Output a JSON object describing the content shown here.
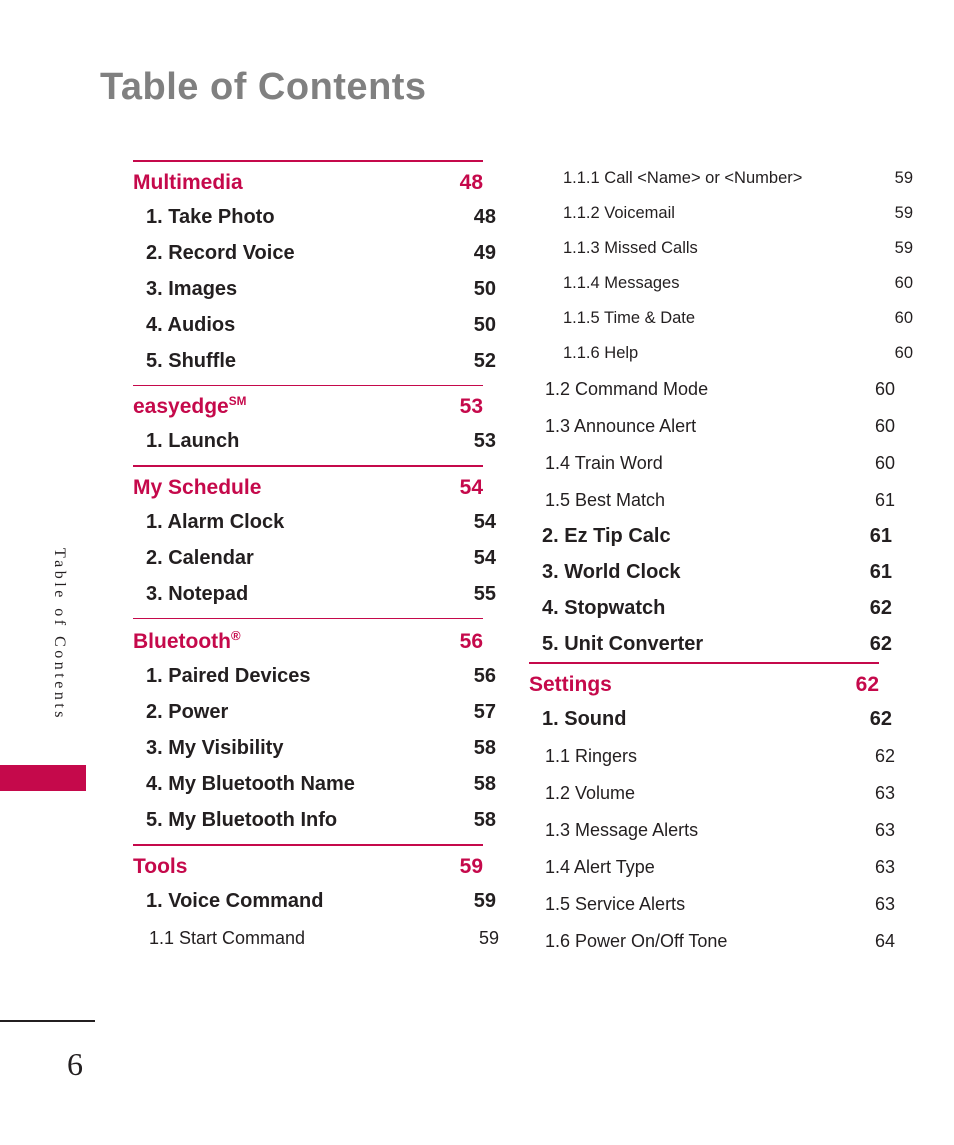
{
  "page": {
    "title": "Table of Contents",
    "side_tab_label": "Table of Contents",
    "page_number": "6",
    "accent_color": "#c5094b",
    "title_color": "#808080",
    "text_color": "#231f20"
  },
  "left_column": [
    {
      "header": {
        "label": "Multimedia",
        "page": "48",
        "level": "header"
      },
      "items": [
        {
          "label": "1. Take Photo",
          "page": "48",
          "level": 1
        },
        {
          "label": "2. Record Voice",
          "page": "49",
          "level": 1
        },
        {
          "label": "3. Images",
          "page": "50",
          "level": 1
        },
        {
          "label": "4. Audios",
          "page": "50",
          "level": 1
        },
        {
          "label": "5. Shuffle",
          "page": "52",
          "level": 1
        }
      ]
    },
    {
      "header": {
        "label": "easyedge",
        "superscript": "SM",
        "page": "53",
        "level": "header"
      },
      "items": [
        {
          "label": "1. Launch",
          "page": "53",
          "level": 1
        }
      ]
    },
    {
      "header": {
        "label": "My Schedule",
        "page": "54",
        "level": "header"
      },
      "items": [
        {
          "label": "1. Alarm Clock",
          "page": "54",
          "level": 1
        },
        {
          "label": "2. Calendar",
          "page": "54",
          "level": 1
        },
        {
          "label": "3. Notepad",
          "page": "55",
          "level": 1
        }
      ]
    },
    {
      "header": {
        "label": "Bluetooth",
        "superscript": "®",
        "page": "56",
        "level": "header"
      },
      "items": [
        {
          "label": "1. Paired Devices",
          "page": "56",
          "level": 1
        },
        {
          "label": "2. Power",
          "page": "57",
          "level": 1
        },
        {
          "label": "3. My Visibility",
          "page": "58",
          "level": 1
        },
        {
          "label": "4. My Bluetooth Name",
          "page": "58",
          "level": 1
        },
        {
          "label": "5. My Bluetooth Info",
          "page": "58",
          "level": 1
        }
      ]
    },
    {
      "header": {
        "label": "Tools",
        "page": "59",
        "level": "header"
      },
      "items": [
        {
          "label": "1. Voice Command",
          "page": "59",
          "level": 1
        },
        {
          "label": "1.1 Start Command",
          "page": "59",
          "level": 2
        }
      ]
    }
  ],
  "right_column": [
    {
      "items": [
        {
          "label": "1.1.1 Call <Name> or <Number>",
          "page": "59",
          "level": 3
        },
        {
          "label": "1.1.2 Voicemail",
          "page": "59",
          "level": 3
        },
        {
          "label": "1.1.3 Missed Calls",
          "page": "59",
          "level": 3
        },
        {
          "label": "1.1.4 Messages",
          "page": "60",
          "level": 3
        },
        {
          "label": "1.1.5 Time & Date",
          "page": "60",
          "level": 3
        },
        {
          "label": "1.1.6 Help",
          "page": "60",
          "level": 3
        },
        {
          "label": "1.2 Command Mode",
          "page": "60",
          "level": 2
        },
        {
          "label": "1.3 Announce Alert",
          "page": "60",
          "level": 2
        },
        {
          "label": "1.4 Train Word",
          "page": "60",
          "level": 2
        },
        {
          "label": "1.5 Best Match",
          "page": "61",
          "level": 2
        },
        {
          "label": "2. Ez Tip Calc",
          "page": "61",
          "level": 1
        },
        {
          "label": "3. World Clock",
          "page": "61",
          "level": 1
        },
        {
          "label": "4. Stopwatch",
          "page": "62",
          "level": 1
        },
        {
          "label": "5. Unit Converter",
          "page": "62",
          "level": 1
        }
      ]
    },
    {
      "header": {
        "label": "Settings",
        "page": "62",
        "level": "header"
      },
      "items": [
        {
          "label": "1. Sound",
          "page": "62",
          "level": 1
        },
        {
          "label": "1.1 Ringers",
          "page": "62",
          "level": 2
        },
        {
          "label": "1.2 Volume",
          "page": "63",
          "level": 2
        },
        {
          "label": "1.3 Message Alerts",
          "page": "63",
          "level": 2
        },
        {
          "label": "1.4 Alert Type",
          "page": "63",
          "level": 2
        },
        {
          "label": "1.5 Service Alerts",
          "page": "63",
          "level": 2
        },
        {
          "label": "1.6 Power On/Off Tone",
          "page": "64",
          "level": 2
        }
      ]
    }
  ]
}
